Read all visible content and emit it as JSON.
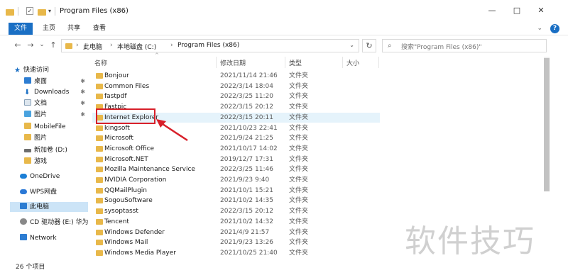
{
  "window": {
    "title": "Program Files (x86)",
    "controls": {
      "minimize": "—",
      "maximize": "□",
      "close": "✕"
    }
  },
  "quick_access_toolbar": {
    "caret": "▾",
    "check": "✓"
  },
  "ribbon": {
    "tabs": [
      "文件",
      "主页",
      "共享",
      "查看"
    ],
    "collapse": "⌄",
    "help": "?"
  },
  "address_bar": {
    "back": "←",
    "forward": "→",
    "dropdown": "⌄",
    "up": "↑",
    "separator": "›",
    "parts": [
      "此电脑",
      "本地磁盘 (C:)",
      "Program Files (x86)"
    ],
    "refresh": "↻"
  },
  "search": {
    "icon": "⌕",
    "placeholder": "搜索\"Program Files (x86)\""
  },
  "nav_pane": {
    "items": [
      {
        "label": "快速访问",
        "icon": "star",
        "pinned": false
      },
      {
        "label": "桌面",
        "icon": "desktop",
        "pinned": true
      },
      {
        "label": "Downloads",
        "icon": "download",
        "pinned": true
      },
      {
        "label": "文档",
        "icon": "document",
        "pinned": true
      },
      {
        "label": "图片",
        "icon": "picture",
        "pinned": true
      },
      {
        "label": "MobileFile",
        "icon": "folder",
        "pinned": false
      },
      {
        "label": "图片",
        "icon": "folder",
        "pinned": false
      },
      {
        "label": "新加卷 (D:)",
        "icon": "drive",
        "pinned": false
      },
      {
        "label": "游戏",
        "icon": "folder",
        "pinned": false
      },
      {
        "label": "OneDrive",
        "icon": "cloud",
        "pinned": false
      },
      {
        "label": "WPS网盘",
        "icon": "wps-cloud",
        "pinned": false
      },
      {
        "label": "此电脑",
        "icon": "pc",
        "pinned": false,
        "selected": true
      },
      {
        "label": "CD 驱动器 (E:) 华为手",
        "icon": "cd",
        "pinned": false
      },
      {
        "label": "Network",
        "icon": "network",
        "pinned": false
      }
    ],
    "pin_glyph": "📌",
    "expand_glyph": "›"
  },
  "columns": {
    "name": "名称",
    "date": "修改日期",
    "type": "类型",
    "size": "大小",
    "sort_caret": "^"
  },
  "files": [
    {
      "name": "Bonjour",
      "date": "2021/11/14 21:46",
      "type": "文件夹"
    },
    {
      "name": "Common Files",
      "date": "2022/3/14 18:04",
      "type": "文件夹"
    },
    {
      "name": "fastpdf",
      "date": "2022/3/25 11:20",
      "type": "文件夹"
    },
    {
      "name": "Fastpic",
      "date": "2022/3/15 20:12",
      "type": "文件夹"
    },
    {
      "name": "Internet Explorer",
      "date": "2022/3/15 20:11",
      "type": "文件夹",
      "highlighted": true
    },
    {
      "name": "kingsoft",
      "date": "2021/10/23 22:41",
      "type": "文件夹"
    },
    {
      "name": "Microsoft",
      "date": "2021/9/24 21:25",
      "type": "文件夹"
    },
    {
      "name": "Microsoft Office",
      "date": "2021/10/17 14:02",
      "type": "文件夹"
    },
    {
      "name": "Microsoft.NET",
      "date": "2019/12/7 17:31",
      "type": "文件夹"
    },
    {
      "name": "Mozilla Maintenance Service",
      "date": "2022/3/25 11:46",
      "type": "文件夹"
    },
    {
      "name": "NVIDIA Corporation",
      "date": "2021/9/23 9:40",
      "type": "文件夹"
    },
    {
      "name": "QQMailPlugin",
      "date": "2021/10/1 15:21",
      "type": "文件夹"
    },
    {
      "name": "SogouSoftware",
      "date": "2021/10/2 14:35",
      "type": "文件夹"
    },
    {
      "name": "sysoptasst",
      "date": "2022/3/15 20:12",
      "type": "文件夹"
    },
    {
      "name": "Tencent",
      "date": "2021/10/2 14:32",
      "type": "文件夹"
    },
    {
      "name": "Windows Defender",
      "date": "2021/4/9 21:57",
      "type": "文件夹"
    },
    {
      "name": "Windows Mail",
      "date": "2021/9/23 13:26",
      "type": "文件夹"
    },
    {
      "name": "Windows Media Player",
      "date": "2021/10/25 21:40",
      "type": "文件夹"
    }
  ],
  "status_bar": {
    "count": "26 个项目"
  },
  "watermark": "软件技巧",
  "colors": {
    "accent": "#1a6fc4",
    "folder": "#e8b84a",
    "callout": "#d8202a",
    "row_highlight": "#e5f3fb"
  }
}
